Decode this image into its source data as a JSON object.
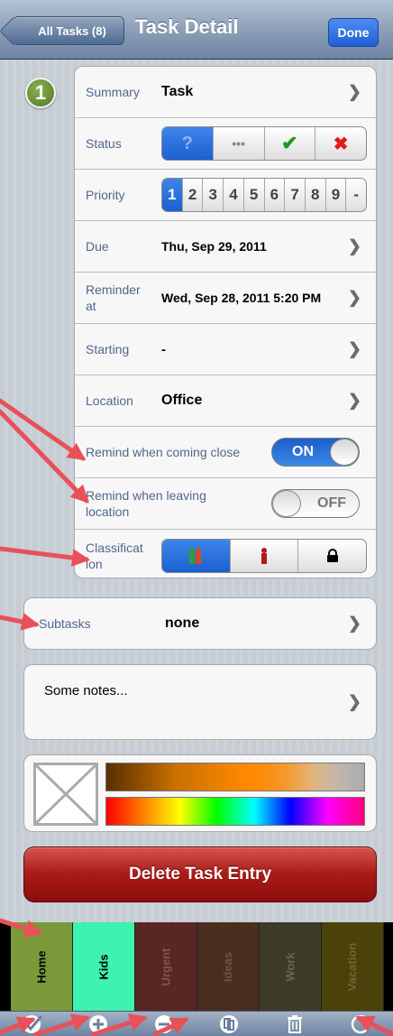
{
  "nav": {
    "back_label": "All Tasks (8)",
    "title": "Task Detail",
    "done_label": "Done"
  },
  "badge": {
    "number": "1"
  },
  "fields": {
    "summary_label": "Summary",
    "summary_value": "Task",
    "status_label": "Status",
    "status_options": [
      "?",
      "•••",
      "✔",
      "✖"
    ],
    "priority_label": "Priority",
    "priority_options": [
      "1",
      "2",
      "3",
      "4",
      "5",
      "6",
      "7",
      "8",
      "9",
      "-"
    ],
    "due_label": "Due",
    "due_value": "Thu, Sep 29, 2011",
    "reminder_label": "Reminder at",
    "reminder_value": "Wed, Sep 28, 2011 5:20 PM",
    "starting_label": "Starting",
    "starting_value": "-",
    "location_label": "Location",
    "location_value": "Office",
    "remind_close_label": "Remind when coming close",
    "remind_close_toggle": "ON",
    "remind_leave_label": "Remind when leaving location",
    "remind_leave_toggle": "OFF",
    "classification_label": "Classificat ion"
  },
  "subtasks": {
    "label": "Subtasks",
    "value": "none"
  },
  "notes": {
    "text": "Some notes..."
  },
  "colors": {
    "accent": "#1a60d0",
    "delete": "#a81a16"
  },
  "delete_label": "Delete Task Entry",
  "categories": [
    {
      "label": "Home",
      "bg": "#7a9a3a",
      "fg": "#000000"
    },
    {
      "label": "Kids",
      "bg": "#3ef2b0",
      "fg": "#000000"
    },
    {
      "label": "Urgent",
      "bg": "#5a2624",
      "fg": "#7d5552"
    },
    {
      "label": "Ideas",
      "bg": "#4a2d1f",
      "fg": "#6e5547"
    },
    {
      "label": "Work",
      "bg": "#3e3a2a",
      "fg": "#696353"
    },
    {
      "label": "Vacation",
      "bg": "#4a420a",
      "fg": "#6e6735"
    }
  ],
  "toolbar_icons": [
    "check-icon",
    "plus-icon",
    "minus-icon",
    "duplicate-icon",
    "trash-icon",
    "search-icon"
  ]
}
